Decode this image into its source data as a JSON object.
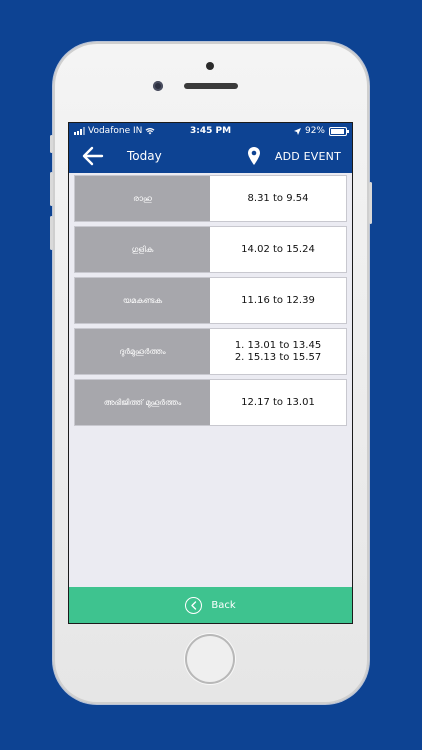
{
  "status": {
    "carrier": "Vodafone IN",
    "time": "3:45 PM",
    "battery": "92%",
    "battery_level": 0.92
  },
  "header": {
    "title": "Today",
    "action_label": "ADD EVENT",
    "back_icon": "arrow-left-icon",
    "location_icon": "location-pin-icon"
  },
  "times": [
    {
      "label": "രാഹു",
      "value": "8.31 to 9.54"
    },
    {
      "label": "ഗുളിക",
      "value": "14.02 to 15.24"
    },
    {
      "label": "യമകണ്ടക",
      "value": "11.16 to 12.39"
    },
    {
      "label": "ദുർമുഹൂർത്തം",
      "value": "1. 13.01 to 13.45\n2. 15.13 to 15.57"
    },
    {
      "label": "അഭിജിത്ത് മുഹൂർത്തം",
      "value": "12.17 to 13.01"
    }
  ],
  "footer": {
    "back_label": "Back",
    "back_icon": "chevron-left-circle-icon"
  },
  "colors": {
    "background": "#0d4393",
    "header": "#0d4393",
    "label_cell": "#a7a7ac",
    "footer": "#3ec38f"
  }
}
